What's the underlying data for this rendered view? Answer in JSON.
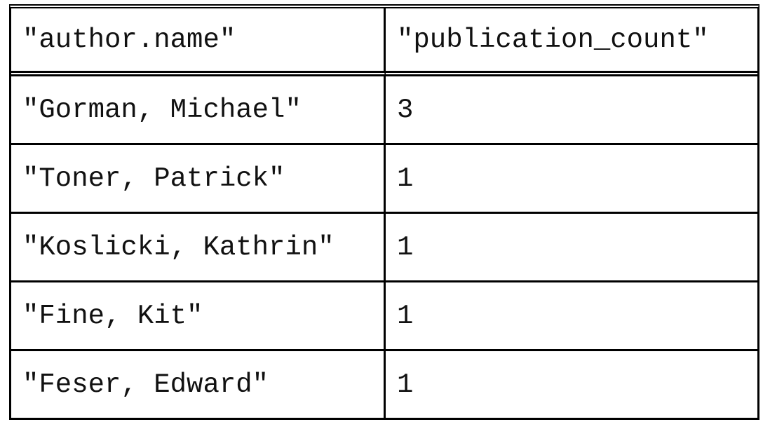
{
  "table": {
    "headers": [
      "\"author.name\"",
      "\"publication_count\""
    ],
    "rows": [
      [
        "\"Gorman, Michael\"",
        "3"
      ],
      [
        "\"Toner, Patrick\"",
        "1"
      ],
      [
        "\"Koslicki, Kathrin\"",
        "1"
      ],
      [
        "\"Fine, Kit\"",
        "1"
      ],
      [
        "\"Feser, Edward\"",
        "1"
      ]
    ]
  }
}
